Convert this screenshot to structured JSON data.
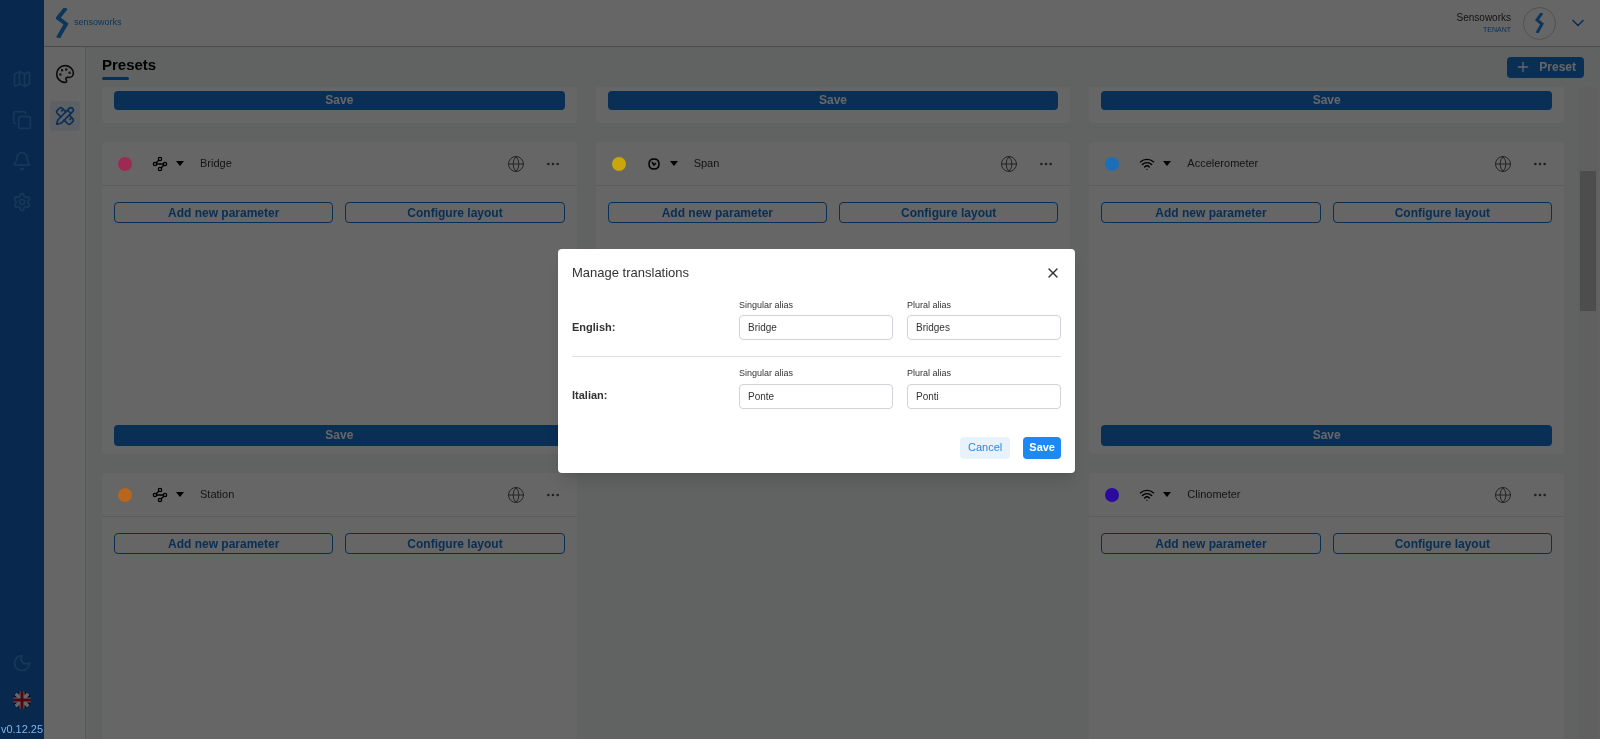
{
  "brand": {
    "logo_text": "sensoworks"
  },
  "user": {
    "name": "Sensoworks",
    "role": "TENANT"
  },
  "rail": {
    "items": [
      {
        "kind": "map"
      },
      {
        "kind": "docs"
      },
      {
        "kind": "bell"
      },
      {
        "kind": "gear"
      }
    ],
    "version": "v0.12.25"
  },
  "subnav": {
    "items": [
      {
        "kind": "palette",
        "selected": false
      },
      {
        "kind": "tools",
        "selected": true
      }
    ]
  },
  "page": {
    "title": "Presets",
    "add_button": "Preset"
  },
  "columns": [
    {
      "cards": [
        {
          "kind": "partial",
          "save": "Save"
        },
        {
          "kind": "full",
          "color": "#9c2a52",
          "symbol": {
            "kind": "nodes"
          },
          "name": "Bridge",
          "buttons": [
            "Add new parameter",
            "Configure layout"
          ],
          "save": "Save"
        },
        {
          "kind": "open",
          "color": "#b8651e",
          "symbol": {
            "kind": "nodes"
          },
          "name": "Station",
          "buttons": [
            "Add new parameter",
            "Configure layout"
          ]
        }
      ]
    },
    {
      "cards": [
        {
          "kind": "partial",
          "save": "Save"
        },
        {
          "kind": "full",
          "color": "#c9a60c",
          "symbol": {
            "kind": "blob"
          },
          "name": "Span",
          "buttons": [
            "Add new parameter",
            "Configure layout"
          ]
        }
      ]
    },
    {
      "cards": [
        {
          "kind": "partial",
          "save": "Save"
        },
        {
          "kind": "full",
          "color": "#1a6fb8",
          "symbol": {
            "kind": "wifi"
          },
          "name": "Accelerometer",
          "buttons": [
            "Add new parameter",
            "Configure layout"
          ],
          "save": "Save"
        },
        {
          "kind": "open",
          "color": "#2a0a9e",
          "symbol": {
            "kind": "wifi"
          },
          "name": "Clinometer",
          "buttons": [
            "Add new parameter",
            "Configure layout"
          ]
        }
      ]
    }
  ],
  "dialog": {
    "title": "Manage translations",
    "rows": [
      {
        "language": "English:",
        "singular_label": "Singular alias",
        "singular": "Bridge",
        "plural_label": "Plural alias",
        "plural": "Bridges"
      },
      {
        "language": "Italian:",
        "singular_label": "Singular alias",
        "singular": "Ponte",
        "plural_label": "Plural alias",
        "plural": "Ponti"
      }
    ],
    "cancel": "Cancel",
    "save": "Save"
  }
}
